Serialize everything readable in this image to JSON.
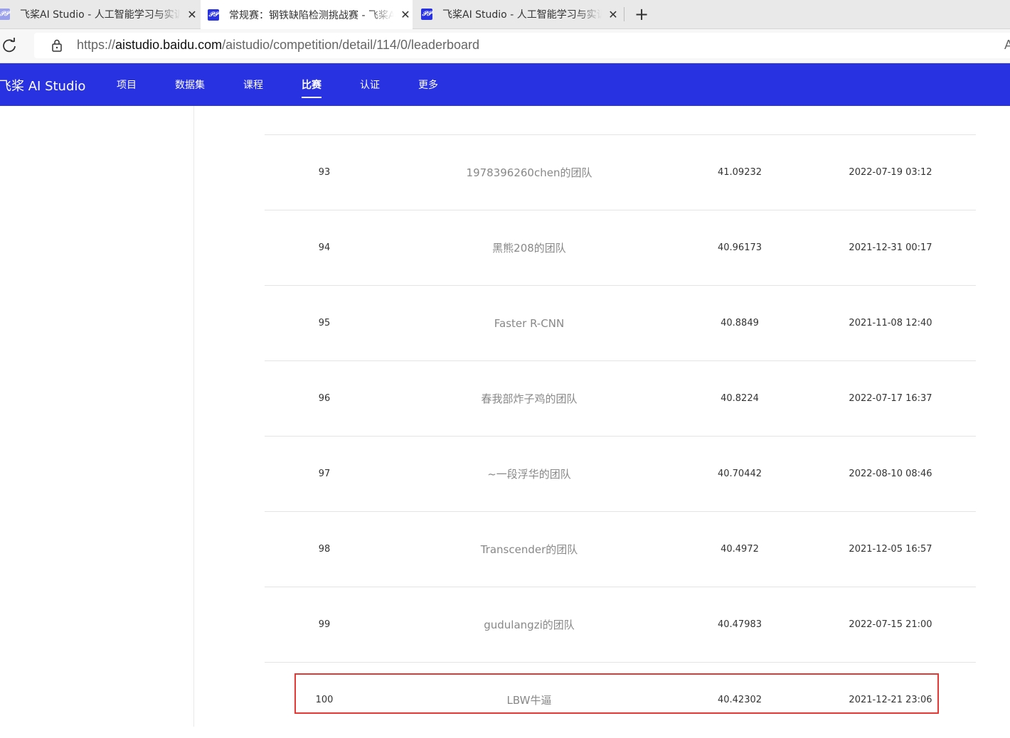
{
  "browser": {
    "tabs": [
      {
        "title": "飞桨AI Studio - 人工智能学习与实训社区",
        "active": false
      },
      {
        "title": "常规赛：钢铁缺陷检测挑战赛 - 飞桨AI Studio",
        "active": true
      },
      {
        "title": "飞桨AI Studio - 人工智能学习与实训社区",
        "active": false
      }
    ],
    "favicon_text": "𝒫𝒫",
    "close_glyph": "✕",
    "newtab_glyph": "+",
    "url_scheme": "https://",
    "url_host": "aistudio.baidu.com",
    "url_path": "/aistudio/competition/detail/114/0/leaderboard",
    "readaloud_glyph": "A"
  },
  "site": {
    "brand": "飞桨 AI Studio",
    "nav": [
      {
        "label": "项目",
        "active": false
      },
      {
        "label": "数据集",
        "active": false
      },
      {
        "label": "课程",
        "active": false
      },
      {
        "label": "比赛",
        "active": true
      },
      {
        "label": "认证",
        "active": false
      },
      {
        "label": "更多",
        "active": false
      }
    ],
    "accent_color": "#2932e1",
    "highlight_color": "#e53935"
  },
  "leaderboard": {
    "rows": [
      {
        "rank": "93",
        "team": "1978396260chen的团队",
        "score": "41.09232",
        "time": "2022-07-19 03:12"
      },
      {
        "rank": "94",
        "team": "黑熊208的团队",
        "score": "40.96173",
        "time": "2021-12-31 00:17"
      },
      {
        "rank": "95",
        "team": "Faster R-CNN",
        "score": "40.8849",
        "time": "2021-11-08 12:40"
      },
      {
        "rank": "96",
        "team": "春我部炸子鸡的团队",
        "score": "40.8224",
        "time": "2022-07-17 16:37"
      },
      {
        "rank": "97",
        "team": "~一段浮华的团队",
        "score": "40.70442",
        "time": "2022-08-10 08:46"
      },
      {
        "rank": "98",
        "team": "Transcender的团队",
        "score": "40.4972",
        "time": "2021-12-05 16:57"
      },
      {
        "rank": "99",
        "team": "gudulangzi的团队",
        "score": "40.47983",
        "time": "2022-07-15 21:00"
      },
      {
        "rank": "100",
        "team": "LBW牛逼",
        "score": "40.42302",
        "time": "2021-12-21 23:06",
        "highlighted": true
      }
    ]
  }
}
